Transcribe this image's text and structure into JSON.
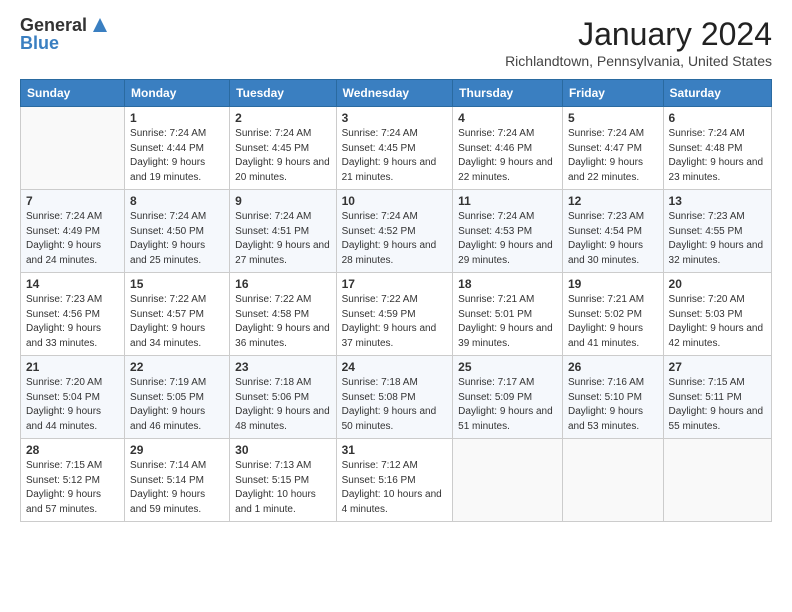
{
  "header": {
    "logo_line1": "General",
    "logo_line2": "Blue",
    "month_title": "January 2024",
    "location": "Richlandtown, Pennsylvania, United States"
  },
  "weekdays": [
    "Sunday",
    "Monday",
    "Tuesday",
    "Wednesday",
    "Thursday",
    "Friday",
    "Saturday"
  ],
  "weeks": [
    [
      {
        "day": "",
        "sunrise": "",
        "sunset": "",
        "daylight": ""
      },
      {
        "day": "1",
        "sunrise": "Sunrise: 7:24 AM",
        "sunset": "Sunset: 4:44 PM",
        "daylight": "Daylight: 9 hours and 19 minutes."
      },
      {
        "day": "2",
        "sunrise": "Sunrise: 7:24 AM",
        "sunset": "Sunset: 4:45 PM",
        "daylight": "Daylight: 9 hours and 20 minutes."
      },
      {
        "day": "3",
        "sunrise": "Sunrise: 7:24 AM",
        "sunset": "Sunset: 4:45 PM",
        "daylight": "Daylight: 9 hours and 21 minutes."
      },
      {
        "day": "4",
        "sunrise": "Sunrise: 7:24 AM",
        "sunset": "Sunset: 4:46 PM",
        "daylight": "Daylight: 9 hours and 22 minutes."
      },
      {
        "day": "5",
        "sunrise": "Sunrise: 7:24 AM",
        "sunset": "Sunset: 4:47 PM",
        "daylight": "Daylight: 9 hours and 22 minutes."
      },
      {
        "day": "6",
        "sunrise": "Sunrise: 7:24 AM",
        "sunset": "Sunset: 4:48 PM",
        "daylight": "Daylight: 9 hours and 23 minutes."
      }
    ],
    [
      {
        "day": "7",
        "sunrise": "Sunrise: 7:24 AM",
        "sunset": "Sunset: 4:49 PM",
        "daylight": "Daylight: 9 hours and 24 minutes."
      },
      {
        "day": "8",
        "sunrise": "Sunrise: 7:24 AM",
        "sunset": "Sunset: 4:50 PM",
        "daylight": "Daylight: 9 hours and 25 minutes."
      },
      {
        "day": "9",
        "sunrise": "Sunrise: 7:24 AM",
        "sunset": "Sunset: 4:51 PM",
        "daylight": "Daylight: 9 hours and 27 minutes."
      },
      {
        "day": "10",
        "sunrise": "Sunrise: 7:24 AM",
        "sunset": "Sunset: 4:52 PM",
        "daylight": "Daylight: 9 hours and 28 minutes."
      },
      {
        "day": "11",
        "sunrise": "Sunrise: 7:24 AM",
        "sunset": "Sunset: 4:53 PM",
        "daylight": "Daylight: 9 hours and 29 minutes."
      },
      {
        "day": "12",
        "sunrise": "Sunrise: 7:23 AM",
        "sunset": "Sunset: 4:54 PM",
        "daylight": "Daylight: 9 hours and 30 minutes."
      },
      {
        "day": "13",
        "sunrise": "Sunrise: 7:23 AM",
        "sunset": "Sunset: 4:55 PM",
        "daylight": "Daylight: 9 hours and 32 minutes."
      }
    ],
    [
      {
        "day": "14",
        "sunrise": "Sunrise: 7:23 AM",
        "sunset": "Sunset: 4:56 PM",
        "daylight": "Daylight: 9 hours and 33 minutes."
      },
      {
        "day": "15",
        "sunrise": "Sunrise: 7:22 AM",
        "sunset": "Sunset: 4:57 PM",
        "daylight": "Daylight: 9 hours and 34 minutes."
      },
      {
        "day": "16",
        "sunrise": "Sunrise: 7:22 AM",
        "sunset": "Sunset: 4:58 PM",
        "daylight": "Daylight: 9 hours and 36 minutes."
      },
      {
        "day": "17",
        "sunrise": "Sunrise: 7:22 AM",
        "sunset": "Sunset: 4:59 PM",
        "daylight": "Daylight: 9 hours and 37 minutes."
      },
      {
        "day": "18",
        "sunrise": "Sunrise: 7:21 AM",
        "sunset": "Sunset: 5:01 PM",
        "daylight": "Daylight: 9 hours and 39 minutes."
      },
      {
        "day": "19",
        "sunrise": "Sunrise: 7:21 AM",
        "sunset": "Sunset: 5:02 PM",
        "daylight": "Daylight: 9 hours and 41 minutes."
      },
      {
        "day": "20",
        "sunrise": "Sunrise: 7:20 AM",
        "sunset": "Sunset: 5:03 PM",
        "daylight": "Daylight: 9 hours and 42 minutes."
      }
    ],
    [
      {
        "day": "21",
        "sunrise": "Sunrise: 7:20 AM",
        "sunset": "Sunset: 5:04 PM",
        "daylight": "Daylight: 9 hours and 44 minutes."
      },
      {
        "day": "22",
        "sunrise": "Sunrise: 7:19 AM",
        "sunset": "Sunset: 5:05 PM",
        "daylight": "Daylight: 9 hours and 46 minutes."
      },
      {
        "day": "23",
        "sunrise": "Sunrise: 7:18 AM",
        "sunset": "Sunset: 5:06 PM",
        "daylight": "Daylight: 9 hours and 48 minutes."
      },
      {
        "day": "24",
        "sunrise": "Sunrise: 7:18 AM",
        "sunset": "Sunset: 5:08 PM",
        "daylight": "Daylight: 9 hours and 50 minutes."
      },
      {
        "day": "25",
        "sunrise": "Sunrise: 7:17 AM",
        "sunset": "Sunset: 5:09 PM",
        "daylight": "Daylight: 9 hours and 51 minutes."
      },
      {
        "day": "26",
        "sunrise": "Sunrise: 7:16 AM",
        "sunset": "Sunset: 5:10 PM",
        "daylight": "Daylight: 9 hours and 53 minutes."
      },
      {
        "day": "27",
        "sunrise": "Sunrise: 7:15 AM",
        "sunset": "Sunset: 5:11 PM",
        "daylight": "Daylight: 9 hours and 55 minutes."
      }
    ],
    [
      {
        "day": "28",
        "sunrise": "Sunrise: 7:15 AM",
        "sunset": "Sunset: 5:12 PM",
        "daylight": "Daylight: 9 hours and 57 minutes."
      },
      {
        "day": "29",
        "sunrise": "Sunrise: 7:14 AM",
        "sunset": "Sunset: 5:14 PM",
        "daylight": "Daylight: 9 hours and 59 minutes."
      },
      {
        "day": "30",
        "sunrise": "Sunrise: 7:13 AM",
        "sunset": "Sunset: 5:15 PM",
        "daylight": "Daylight: 10 hours and 1 minute."
      },
      {
        "day": "31",
        "sunrise": "Sunrise: 7:12 AM",
        "sunset": "Sunset: 5:16 PM",
        "daylight": "Daylight: 10 hours and 4 minutes."
      },
      {
        "day": "",
        "sunrise": "",
        "sunset": "",
        "daylight": ""
      },
      {
        "day": "",
        "sunrise": "",
        "sunset": "",
        "daylight": ""
      },
      {
        "day": "",
        "sunrise": "",
        "sunset": "",
        "daylight": ""
      }
    ]
  ]
}
